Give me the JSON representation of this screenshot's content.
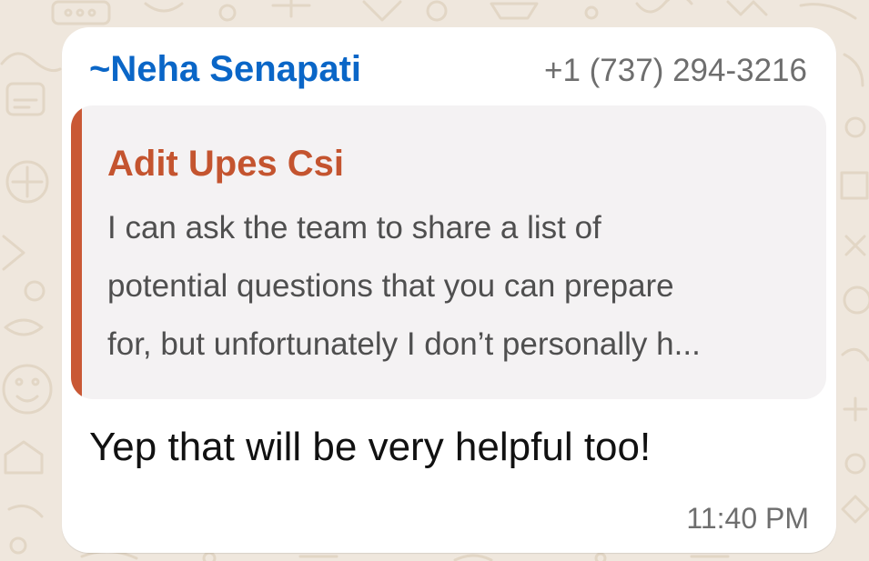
{
  "wallpaper": {
    "background_color": "#efe7dd",
    "doodle_color": "#e2d6c5"
  },
  "message": {
    "sender_prefix": "~",
    "sender_name": "Neha Senapati",
    "sender_phone": "+1 (737) 294-3216",
    "sender_color": "#0a66c7",
    "reply": {
      "author": "Adit Upes Csi",
      "author_color": "#c4542f",
      "bar_color": "#c95835",
      "lines": [
        "I can ask the team to share a list of",
        "potential questions that you can prepare",
        "for, but unfortunately I don’t personally h..."
      ]
    },
    "text": "Yep that will be very helpful too!",
    "time": "11:40 PM"
  }
}
